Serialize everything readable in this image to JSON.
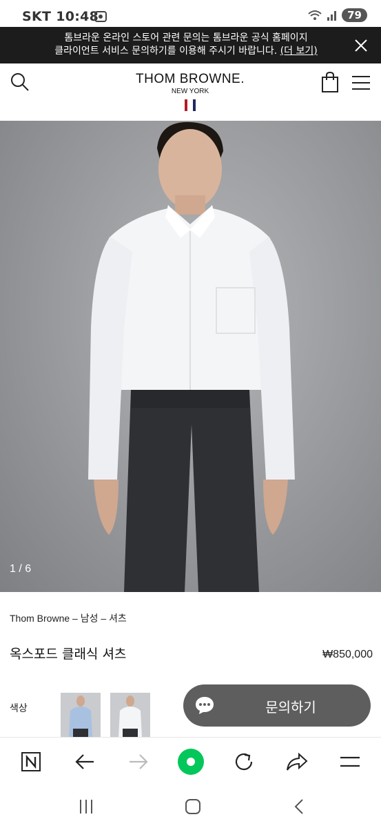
{
  "status_bar": {
    "carrier": "SKT",
    "time": "10:48",
    "battery": "79",
    "icons": [
      "screenshot-icon",
      "wifi-icon",
      "signal-icon",
      "battery-icon"
    ]
  },
  "notice": {
    "line1": "톰브라운 온라인 스토어 관련 문의는 톰브라운 공식 홈페이지",
    "line2": "클라이언트 서비스 문의하기를 이용해 주시기 바랍니다. ",
    "link": "(더 보기)"
  },
  "header": {
    "brand_name": "THOM BROWNE.",
    "brand_sub": "NEW YORK",
    "flag_colors": [
      "#b01e2a",
      "#ffffff",
      "#1f2a5c"
    ]
  },
  "product": {
    "image_counter": "1 / 6",
    "breadcrumb": "Thom Browne – 남성 – 셔츠",
    "name": "옥스포드 클래식 셔츠",
    "price": "₩850,000",
    "color_label": "색상",
    "swatches": [
      "light-blue-shirt",
      "white-shirt"
    ]
  },
  "chat": {
    "label": "문의하기"
  },
  "toolbar": {
    "items": [
      "naver-home-icon",
      "back-icon",
      "forward-icon",
      "green-dot-icon",
      "refresh-icon",
      "share-icon",
      "menu-icon"
    ],
    "accent": "#03c75a"
  },
  "nav": {
    "items": [
      "recent-apps-icon",
      "home-icon",
      "back-icon"
    ]
  }
}
